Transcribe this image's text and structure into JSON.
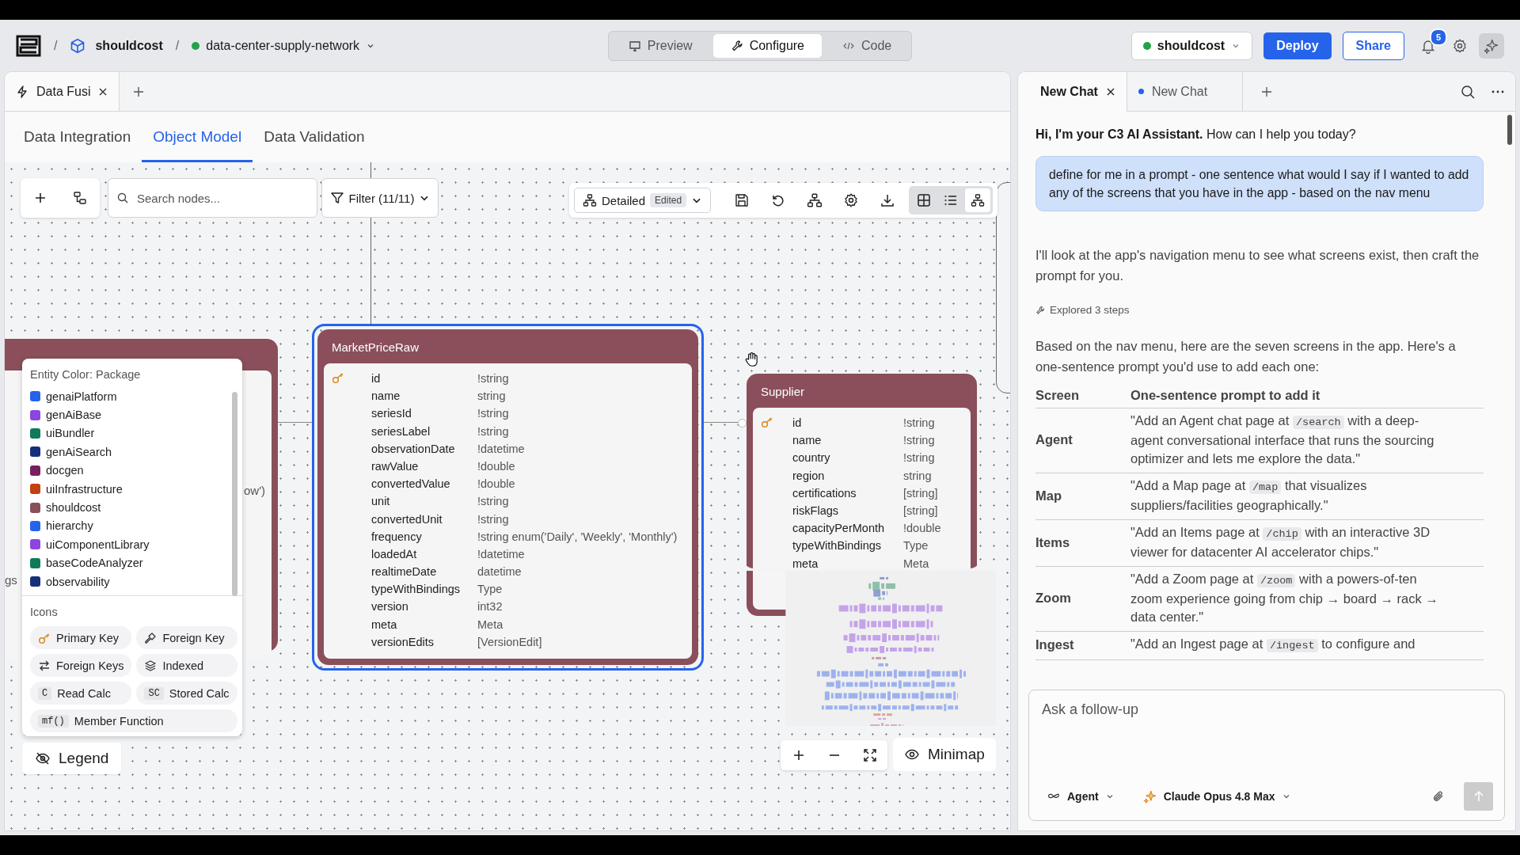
{
  "topbar": {
    "separators": [
      "/",
      "/"
    ],
    "project": "shouldcost",
    "app": {
      "label": "data-center-supply-network"
    },
    "modes": [
      {
        "kind": "monitor",
        "label": "Preview",
        "selected": false
      },
      {
        "kind": "wrench",
        "label": "Configure",
        "selected": true
      },
      {
        "kind": "code",
        "label": "Code",
        "selected": false
      }
    ],
    "environment": {
      "label": "shouldcost"
    },
    "actions": [
      {
        "kind": "primary",
        "label": "Deploy"
      },
      {
        "kind": "secondary",
        "label": "Share"
      }
    ],
    "notifications": {
      "count": "5"
    }
  },
  "editor_tabs": [
    {
      "label": "Data Fusi",
      "selected": true
    }
  ],
  "subtabs": [
    {
      "label": "Data Integration",
      "selected": false
    },
    {
      "label": "Object Model",
      "selected": true
    },
    {
      "label": "Data Validation",
      "selected": false
    }
  ],
  "canvas": {
    "search": {
      "placeholder": "Search nodes..."
    },
    "filter": {
      "label": "Filter (11/11)"
    },
    "view": {
      "label": "Detailed",
      "badge": "Edited"
    },
    "view_modes": [
      {
        "kind": "grid",
        "selected": false
      },
      {
        "kind": "list",
        "selected": false
      },
      {
        "kind": "tree",
        "selected": true
      }
    ],
    "left_node_fragments": [
      "ow')",
      "gs"
    ],
    "entities": [
      {
        "title": "MarketPriceRaw",
        "selected": true,
        "fields": [
          {
            "name": "id",
            "type": "!string",
            "key": true
          },
          {
            "name": "name",
            "type": "string",
            "key": false
          },
          {
            "name": "seriesId",
            "type": "!string",
            "key": false
          },
          {
            "name": "seriesLabel",
            "type": "!string",
            "key": false
          },
          {
            "name": "observationDate",
            "type": "!datetime",
            "key": false
          },
          {
            "name": "rawValue",
            "type": "!double",
            "key": false
          },
          {
            "name": "convertedValue",
            "type": "!double",
            "key": false
          },
          {
            "name": "unit",
            "type": "!string",
            "key": false
          },
          {
            "name": "convertedUnit",
            "type": "!string",
            "key": false
          },
          {
            "name": "frequency",
            "type": "!string enum('Daily', 'Weekly', 'Monthly')",
            "key": false
          },
          {
            "name": "loadedAt",
            "type": "!datetime",
            "key": false
          },
          {
            "name": "realtimeDate",
            "type": "datetime",
            "key": false
          },
          {
            "name": "typeWithBindings",
            "type": "Type",
            "key": false
          },
          {
            "name": "version",
            "type": "int32",
            "key": false
          },
          {
            "name": "meta",
            "type": "Meta",
            "key": false
          },
          {
            "name": "versionEdits",
            "type": "[VersionEdit]",
            "key": false
          }
        ]
      },
      {
        "title": "Supplier",
        "selected": false,
        "fields": [
          {
            "name": "id",
            "type": "!string",
            "key": true
          },
          {
            "name": "name",
            "type": "!string",
            "key": false
          },
          {
            "name": "country",
            "type": "!string",
            "key": false
          },
          {
            "name": "region",
            "type": "string",
            "key": false
          },
          {
            "name": "certifications",
            "type": "[string]",
            "key": false
          },
          {
            "name": "riskFlags",
            "type": "[string]",
            "key": false
          },
          {
            "name": "capacityPerMonth",
            "type": "!double",
            "key": false
          },
          {
            "name": "typeWithBindings",
            "type": "Type",
            "key": false
          },
          {
            "name": "meta",
            "type": "Meta",
            "key": false
          }
        ]
      }
    ],
    "legend": {
      "title": "Entity Color: Package",
      "packages": [
        {
          "name": "genaiPlatform",
          "color": "#2563eb"
        },
        {
          "name": "genAiBase",
          "color": "#8b45e0"
        },
        {
          "name": "uiBundler",
          "color": "#0f7a5a"
        },
        {
          "name": "genAiSearch",
          "color": "#14307a"
        },
        {
          "name": "docgen",
          "color": "#7a1f5c"
        },
        {
          "name": "uiInfrastructure",
          "color": "#c2410c"
        },
        {
          "name": "shouldcost",
          "color": "#8b4f5a"
        },
        {
          "name": "hierarchy",
          "color": "#2563eb"
        },
        {
          "name": "uiComponentLibrary",
          "color": "#8b45e0"
        },
        {
          "name": "baseCodeAnalyzer",
          "color": "#0f7a5a"
        },
        {
          "name": "observability",
          "color": "#14307a"
        }
      ],
      "icons_title": "Icons",
      "icons": [
        {
          "kind": "primary-key",
          "label": "Primary Key"
        },
        {
          "kind": "foreign-key",
          "label": "Foreign Key"
        },
        {
          "kind": "foreign-keys",
          "label": "Foreign Keys"
        },
        {
          "kind": "indexed",
          "label": "Indexed"
        },
        {
          "kind": "badge",
          "badge": "C",
          "label": "Read Calc"
        },
        {
          "kind": "badge",
          "badge": "SC",
          "label": "Stored Calc"
        },
        {
          "kind": "badge",
          "badge": "mf()",
          "label": "Member Function"
        }
      ]
    },
    "legend_button": {
      "label": "Legend"
    },
    "minimap_button": {
      "label": "Minimap"
    }
  },
  "chat": {
    "tabs": [
      {
        "label": "New Chat",
        "selected": true,
        "unsaved": false
      },
      {
        "label": "New Chat",
        "selected": false,
        "unsaved": true
      }
    ],
    "greeting": "**Hi, I'm your C3 AI Assistant.** How can I help you today?",
    "user_message": "define for me in a prompt - one sentence what would I say if I wanted to add any of the screens that you have in the app - based on the nav menu",
    "reply_intro": "I'll look at the app's navigation menu to see what screens exist, then craft the prompt for you.",
    "steps": "Explored 3 steps",
    "answer_intro": "Based on the nav menu, here are the seven screens in the app. Here's a one-sentence prompt you'd use to add each one:",
    "table": {
      "columns": [
        "Screen",
        "One-sentence prompt to add it"
      ],
      "rows": [
        {
          "screen": "Agent",
          "before": "\"Add an Agent chat page at ",
          "path": "/search",
          "after": " with a deep-agent conversational interface that runs the sourcing optimizer and lets me explore the data.\""
        },
        {
          "screen": "Map",
          "before": "\"Add a Map page at ",
          "path": "/map",
          "after": " that visualizes suppliers/facilities geographically.\""
        },
        {
          "screen": "Items",
          "before": "\"Add an Items page at ",
          "path": "/chip",
          "after": " with an interactive 3D viewer for datacenter AI accelerator chips.\""
        },
        {
          "screen": "Zoom",
          "before": "\"Add a Zoom page at ",
          "path": "/zoom",
          "after": " with a powers-of-ten zoom experience going from chip → board → rack → data center.\""
        },
        {
          "screen": "Ingest",
          "before": "\"Add an Ingest page at ",
          "path": "/ingest",
          "after": " to configure and"
        }
      ]
    },
    "input": {
      "placeholder": "Ask a follow-up"
    },
    "mode": {
      "label": "Agent"
    },
    "model": {
      "label": "Claude Opus 4.8 Max"
    }
  }
}
